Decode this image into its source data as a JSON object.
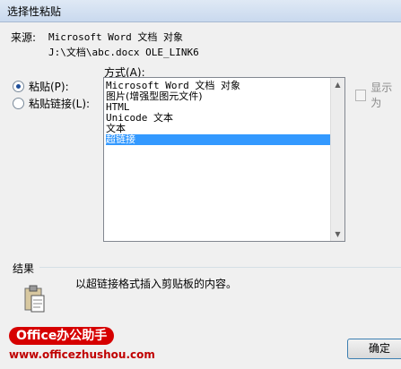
{
  "dialog": {
    "title": "选择性粘贴"
  },
  "source": {
    "label": "来源:",
    "line1": "Microsoft Word 文档 对象",
    "line2": "J:\\文档\\abc.docx OLE_LINK6"
  },
  "paste_options": {
    "paste": "粘贴(P):",
    "paste_link": "粘贴链接(L):",
    "selected": "paste"
  },
  "as_label": "方式(A):",
  "formats": [
    "Microsoft Word 文档 对象",
    "图片(增强型图元文件)",
    "HTML",
    "Unicode 文本",
    "文本",
    "超链接"
  ],
  "selected_format_index": 5,
  "display_as_icon": {
    "label": "显示为",
    "checked": false
  },
  "result": {
    "label": "结果",
    "text": "以超链接格式插入剪贴板的内容。"
  },
  "buttons": {
    "ok": "确定"
  },
  "watermark": {
    "logo": "Office办公助手",
    "url": "www.officezhushou.com"
  }
}
